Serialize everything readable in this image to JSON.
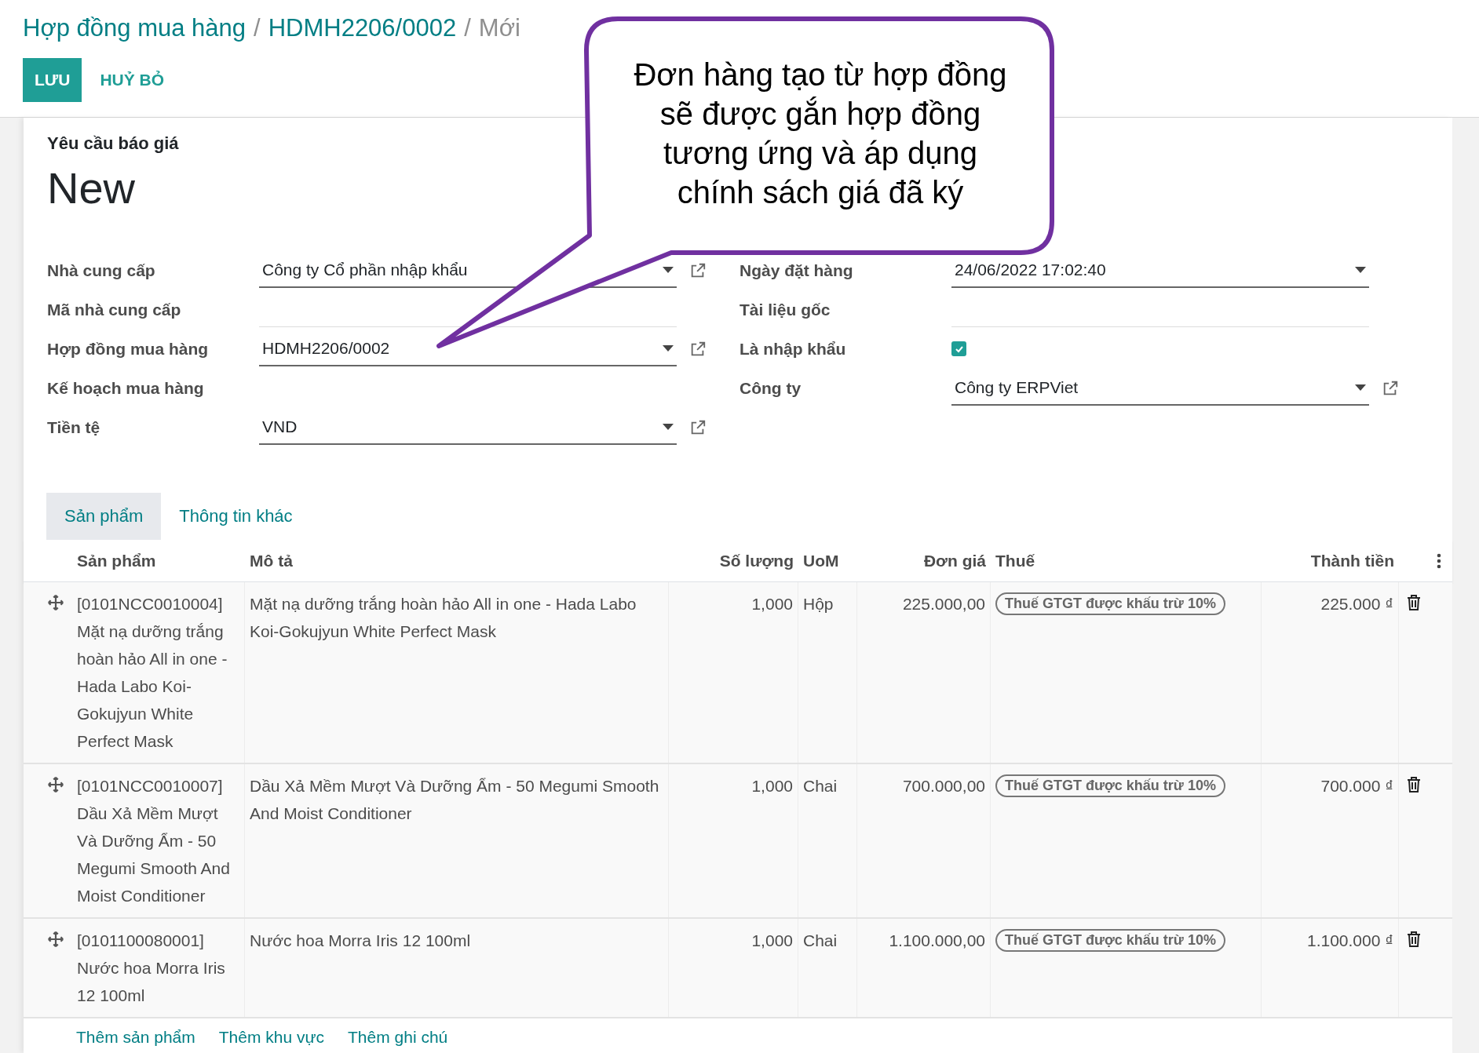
{
  "breadcrumb": [
    {
      "label": "Hợp đồng mua hàng",
      "kind": "link"
    },
    {
      "label": "/",
      "kind": "separator"
    },
    {
      "label": "HDMH2206/0002",
      "kind": "link"
    },
    {
      "label": "/",
      "kind": "separator"
    },
    {
      "label": "Mới",
      "kind": "current"
    }
  ],
  "buttons": [
    {
      "label": "LƯU",
      "kind": "primary"
    },
    {
      "label": "HUỶ BỎ",
      "kind": "secondary"
    }
  ],
  "sheet": {
    "subtitle": "Yêu cầu báo giá",
    "title": "New"
  },
  "fields_left": [
    {
      "label": "Nhà cung cấp",
      "kind": "select",
      "value": "Công ty Cổ phần nhập khẩu",
      "dropdown": true,
      "external_link": true
    },
    {
      "label": "Mã nhà cung cấp",
      "kind": "text"
    },
    {
      "label": "Hợp đồng mua hàng",
      "kind": "select",
      "value": "HDMH2206/0002",
      "dropdown": true,
      "external_link": true
    },
    {
      "label": "Kế hoạch mua hàng",
      "kind": "plain"
    },
    {
      "label": "Tiền tệ",
      "kind": "select",
      "value": "VND",
      "dropdown": true,
      "external_link": true
    }
  ],
  "fields_right": [
    {
      "label": "Ngày đặt hàng",
      "kind": "select",
      "value": "24/06/2022 17:02:40",
      "dropdown": true,
      "external_link": false
    },
    {
      "label": "Tài liệu gốc",
      "kind": "text"
    },
    {
      "label": "Là nhập khẩu",
      "kind": "checkbox",
      "checked": true
    },
    {
      "label": "Công ty",
      "kind": "select",
      "value": "Công ty ERPViet",
      "dropdown": true,
      "external_link": true
    }
  ],
  "tabs": [
    {
      "label": "Sản phẩm",
      "selected": true
    },
    {
      "label": "Thông tin khác",
      "selected": false
    }
  ],
  "table": {
    "columns": [
      "Sản phẩm",
      "Mô tả",
      "Số lượng",
      "UoM",
      "Đơn giá",
      "Thuế",
      "Thành tiền"
    ],
    "rows": [
      {
        "product": "[0101NCC0010004] Mặt nạ dưỡng trắng hoàn hảo All in one - Hada Labo Koi-Gokujyun White Perfect Mask",
        "description": "Mặt nạ dưỡng trắng hoàn hảo All in one - Hada Labo Koi-Gokujyun White Perfect Mask",
        "quantity": "1,000",
        "uom": "Hộp",
        "unit_price": "225.000,00",
        "tax": "Thuế GTGT được khấu trừ 10%",
        "subtotal": "225.000 ₫"
      },
      {
        "product": "[0101NCC0010007] Dầu Xả Mềm Mượt Và Dưỡng Ẩm - 50 Megumi Smooth And Moist Conditioner",
        "description": "Dầu Xả Mềm Mượt Và Dưỡng Ẩm - 50 Megumi Smooth And Moist Conditioner",
        "quantity": "1,000",
        "uom": "Chai",
        "unit_price": "700.000,00",
        "tax": "Thuế GTGT được khấu trừ 10%",
        "subtotal": "700.000 ₫"
      },
      {
        "product": "[0101100080001] Nước hoa Morra Iris 12 100ml",
        "description": "Nước hoa Morra Iris 12 100ml",
        "quantity": "1,000",
        "uom": "Chai",
        "unit_price": "1.100.000,00",
        "tax": "Thuế GTGT được khấu trừ 10%",
        "subtotal": "1.100.000 ₫"
      }
    ]
  },
  "add_links": [
    "Thêm sản phẩm",
    "Thêm khu vực",
    "Thêm ghi chú"
  ],
  "callout": {
    "text": "Đơn hàng tạo từ hợp đồng sẽ được gắn hợp đồng tương ứng và áp dụng chính sách giá đã ký"
  }
}
